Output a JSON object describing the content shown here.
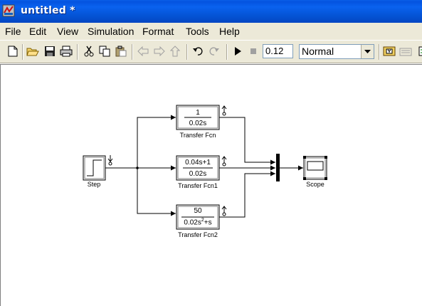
{
  "window": {
    "title": "untitled *"
  },
  "menu": [
    "File",
    "Edit",
    "View",
    "Simulation",
    "Format",
    "Tools",
    "Help"
  ],
  "toolbar": {
    "stop_time": "0.12",
    "sim_mode": "Normal",
    "icons": [
      "new-icon",
      "open-icon",
      "save-icon",
      "print-icon",
      "cut-icon",
      "copy-icon",
      "paste-icon",
      "back-icon",
      "forward-icon",
      "up-icon",
      "undo-icon",
      "redo-icon",
      "start-icon",
      "stop-icon",
      "build-icon",
      "library-icon",
      "model-browser-icon"
    ]
  },
  "diagram": {
    "step": {
      "label": "Step"
    },
    "tf1": {
      "num": "1",
      "den": "0.02s",
      "label": "Transfer Fcn"
    },
    "tf2": {
      "num": "0.04s+1",
      "den": "0.02s",
      "label": "Transfer Fcn1"
    },
    "tf3": {
      "num": "50",
      "den_a": "0.02s",
      "den_sup": "2",
      "den_b": "+s",
      "label": "Transfer Fcn2"
    },
    "scope": {
      "label": "Scope"
    }
  },
  "colors": {
    "titlebar": "#0453df",
    "chrome": "#ece9d8",
    "lines": "#000000"
  }
}
